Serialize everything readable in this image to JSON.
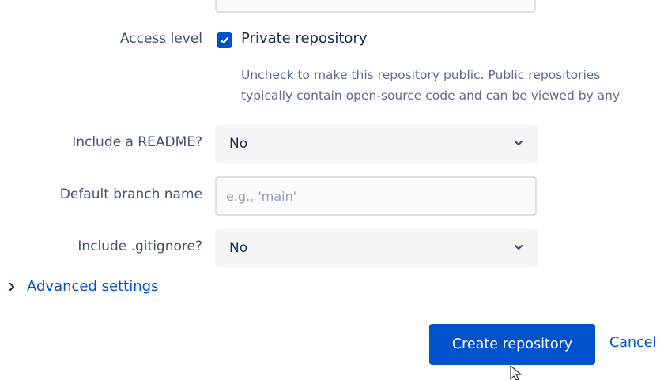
{
  "form": {
    "access_level": {
      "label": "Access level",
      "checkbox_label": "Private repository",
      "checked": true,
      "help_line1": "Uncheck to make this repository public. Public repositories",
      "help_line2": "typically contain open-source code and can be viewed by any"
    },
    "readme": {
      "label": "Include a README?",
      "value": "No"
    },
    "default_branch": {
      "label": "Default branch name",
      "placeholder": "e.g., 'main'",
      "value": ""
    },
    "gitignore": {
      "label": "Include .gitignore?",
      "value": "No"
    },
    "advanced": {
      "label": "Advanced settings"
    },
    "actions": {
      "create_label": "Create repository",
      "cancel_label": "Cancel"
    }
  },
  "icons": {
    "checkbox": "check-icon",
    "select": "chevron-down-icon",
    "advanced": "chevron-right-icon",
    "cursor": "mouse-pointer-icon"
  },
  "colors": {
    "primary": "#0052cc",
    "label_text": "#42526e",
    "help_text": "#5e6c84",
    "field_background": "#f4f5f7"
  }
}
